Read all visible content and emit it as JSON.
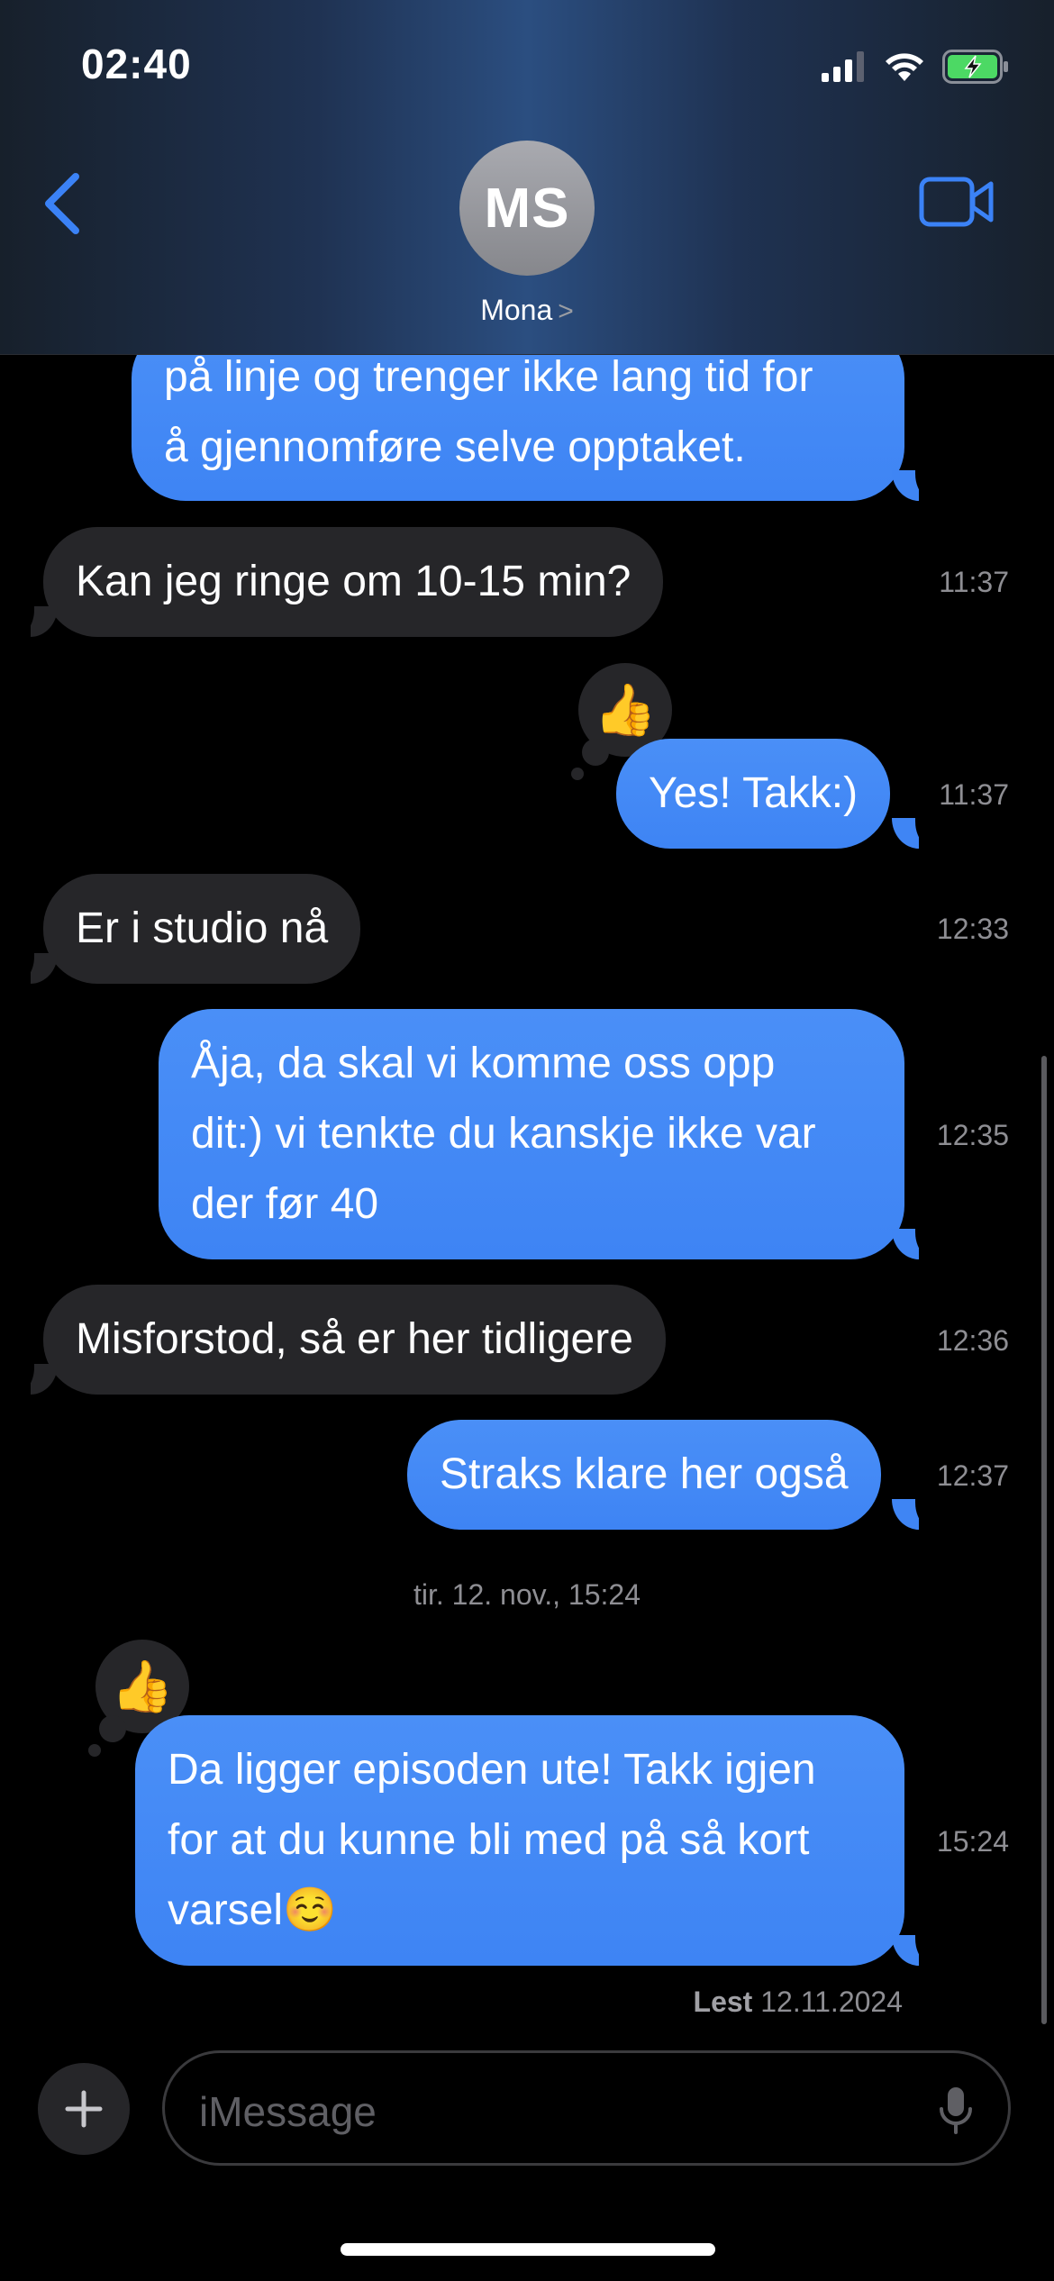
{
  "status_bar": {
    "time": "02:40"
  },
  "header": {
    "avatar_initials": "MS",
    "contact_name": "Mona",
    "chevron": ">"
  },
  "messages": [
    {
      "text": "på linje og trenger ikke lang tid for\nå gjennomføre selve opptaket.",
      "direction": "outgoing",
      "time": ""
    },
    {
      "text": "Kan jeg ringe om 10-15 min?",
      "direction": "incoming",
      "time": "11:37"
    },
    {
      "text": "Yes! Takk:)",
      "direction": "outgoing",
      "time": "11:37",
      "reaction": "👍"
    },
    {
      "text": "Er i studio nå",
      "direction": "incoming",
      "time": "12:33"
    },
    {
      "text": "Åja, da skal vi komme oss opp\ndit:) vi tenkte du kanskje ikke var\nder før 40",
      "direction": "outgoing",
      "time": "12:35"
    },
    {
      "text": "Misforstod, så er her tidligere",
      "direction": "incoming",
      "time": "12:36"
    },
    {
      "text": "Straks klare her også",
      "direction": "outgoing",
      "time": "12:37"
    },
    {
      "text": "Da ligger episoden ute! Takk igjen\nfor at du kunne bli med på så kort\nvarsel☺️",
      "direction": "outgoing",
      "time": "15:24",
      "reaction": "👍"
    }
  ],
  "date_separator": "tir. 12. nov., 15:24",
  "read_receipt": {
    "label": "Lest",
    "date": "12.11.2024"
  },
  "composer": {
    "placeholder": "iMessage",
    "plus": "+"
  },
  "colors": {
    "outgoing_bubble": "#3e84f4",
    "incoming_bubble": "#262629",
    "accent": "#3b82f6",
    "background": "#000000"
  }
}
